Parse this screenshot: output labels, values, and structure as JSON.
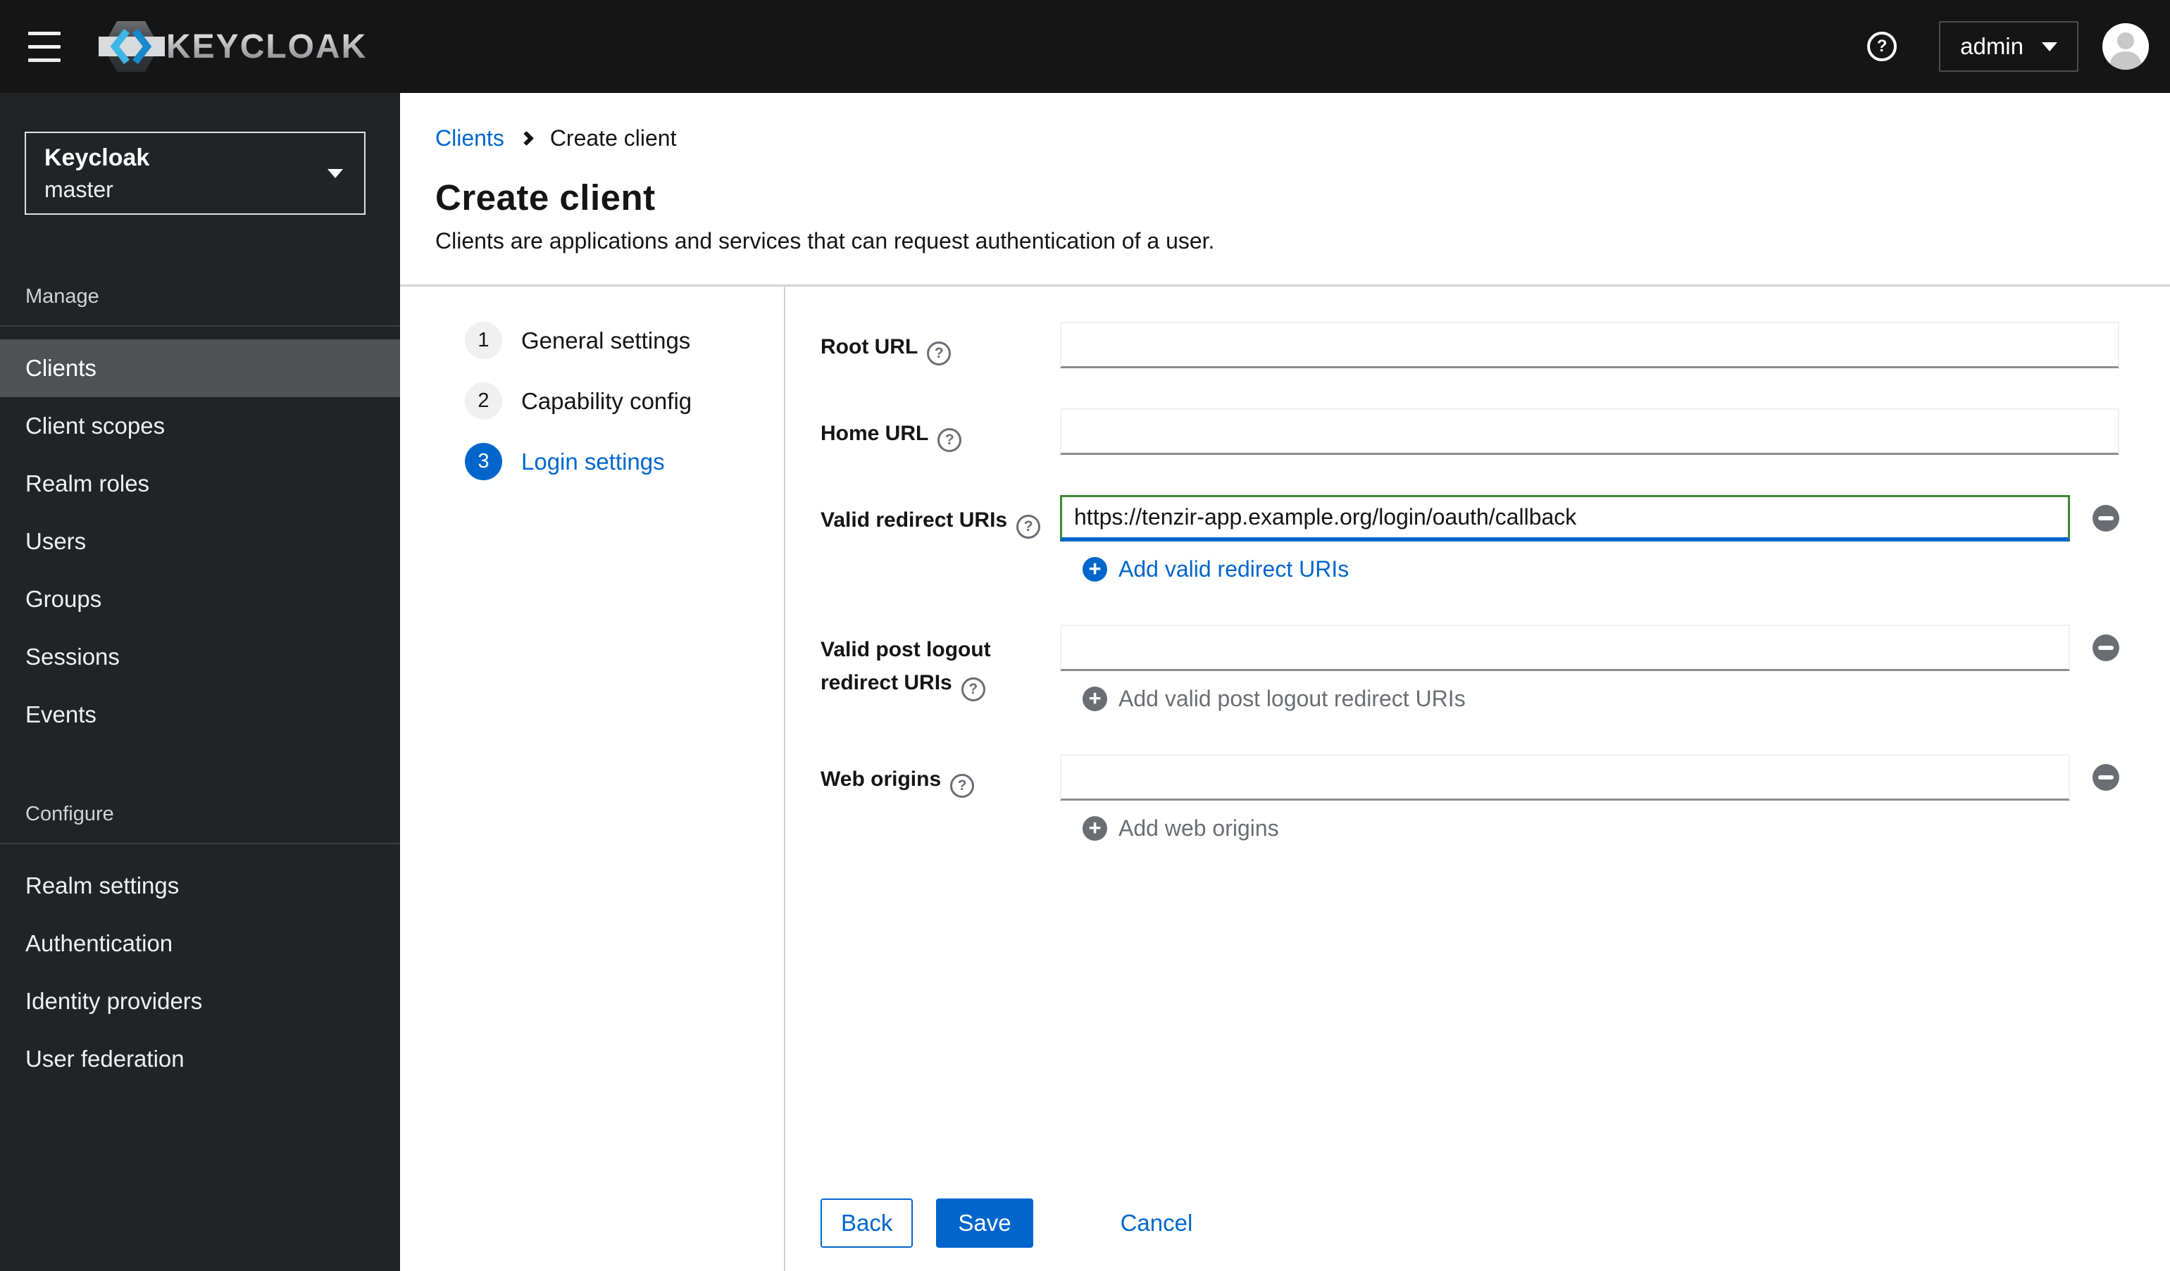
{
  "colors": {
    "accent": "#0066cc",
    "success_border": "#3e8635",
    "masthead_bg": "#151515",
    "sidebar_bg": "#212427",
    "sidebar_active_bg": "#4f5255",
    "muted_gray": "#6a6e73",
    "divider_gray": "#d2d2d2",
    "brand_cyan": "#3db7e8",
    "brand_blue": "#1789cc"
  },
  "masthead": {
    "brand": "KEYCLOAK",
    "user": {
      "label": "admin"
    }
  },
  "sidebar": {
    "realm_selector": {
      "title": "Keycloak",
      "realm": "master"
    },
    "sections": [
      {
        "title": "Manage",
        "items": [
          {
            "label": "Clients",
            "active": true
          },
          {
            "label": "Client scopes",
            "active": false
          },
          {
            "label": "Realm roles",
            "active": false
          },
          {
            "label": "Users",
            "active": false
          },
          {
            "label": "Groups",
            "active": false
          },
          {
            "label": "Sessions",
            "active": false
          },
          {
            "label": "Events",
            "active": false
          }
        ]
      },
      {
        "title": "Configure",
        "items": [
          {
            "label": "Realm settings",
            "active": false
          },
          {
            "label": "Authentication",
            "active": false
          },
          {
            "label": "Identity providers",
            "active": false
          },
          {
            "label": "User federation",
            "active": false
          }
        ]
      }
    ]
  },
  "page": {
    "breadcrumb": {
      "parent": "Clients",
      "current": "Create client"
    },
    "title": "Create client",
    "description": "Clients are applications and services that can request authentication of a user."
  },
  "wizard": {
    "steps": [
      {
        "number": "1",
        "label": "General settings",
        "active": false
      },
      {
        "number": "2",
        "label": "Capability config",
        "active": false
      },
      {
        "number": "3",
        "label": "Login settings",
        "active": true
      }
    ]
  },
  "form": {
    "root_url": {
      "label": "Root URL",
      "value": ""
    },
    "home_url": {
      "label": "Home URL",
      "value": ""
    },
    "valid_redirect_uris": {
      "label": "Valid redirect URIs",
      "value": "https://tenzir-app.example.org/login/oauth/callback",
      "add_label": "Add valid redirect URIs"
    },
    "valid_post_logout_redirect_uris": {
      "label": "Valid post logout redirect URIs",
      "value": "",
      "add_label": "Add valid post logout redirect URIs"
    },
    "web_origins": {
      "label": "Web origins",
      "value": "",
      "add_label": "Add web origins"
    },
    "actions": {
      "back": "Back",
      "save": "Save",
      "cancel": "Cancel"
    }
  }
}
